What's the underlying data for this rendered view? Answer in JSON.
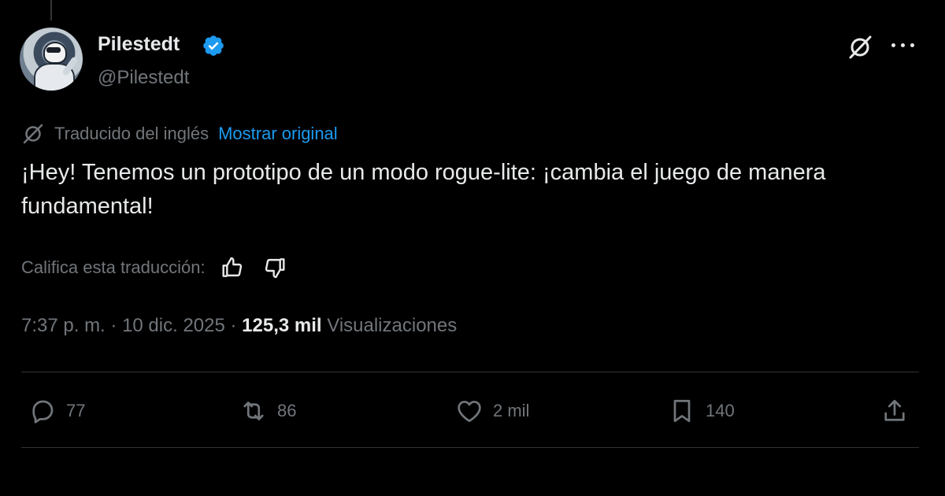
{
  "author": {
    "display_name": "Pilestedt",
    "handle": "@Pilestedt",
    "verified": true
  },
  "translation": {
    "label": "Traducido del inglés",
    "show_original": "Mostrar original"
  },
  "tweet": {
    "text": "¡Hey! Tenemos un prototipo de un modo rogue-lite: ¡cambia el juego de manera fundamental!"
  },
  "rating": {
    "label": "Califica esta traducción:"
  },
  "meta": {
    "time": "7:37 p. m.",
    "date": "10 dic. 2025",
    "separator": " · ",
    "views_count": "125,3 mil",
    "views_label": "Visualizaciones"
  },
  "actions": {
    "replies": "77",
    "reposts": "86",
    "likes": "2 mil",
    "bookmarks": "140"
  },
  "icons": {
    "verified": "verified-badge-icon",
    "grok": "grok-icon",
    "more": "more-icon",
    "translate": "translate-icon",
    "thumbs_up": "thumbs-up-icon",
    "thumbs_down": "thumbs-down-icon",
    "reply": "reply-icon",
    "repost": "repost-icon",
    "like": "heart-icon",
    "bookmark": "bookmark-icon",
    "share": "share-icon"
  },
  "colors": {
    "background": "#000000",
    "text": "#e7e9ea",
    "muted": "#71767b",
    "accent": "#1d9bf0",
    "divider": "#2f3336"
  }
}
